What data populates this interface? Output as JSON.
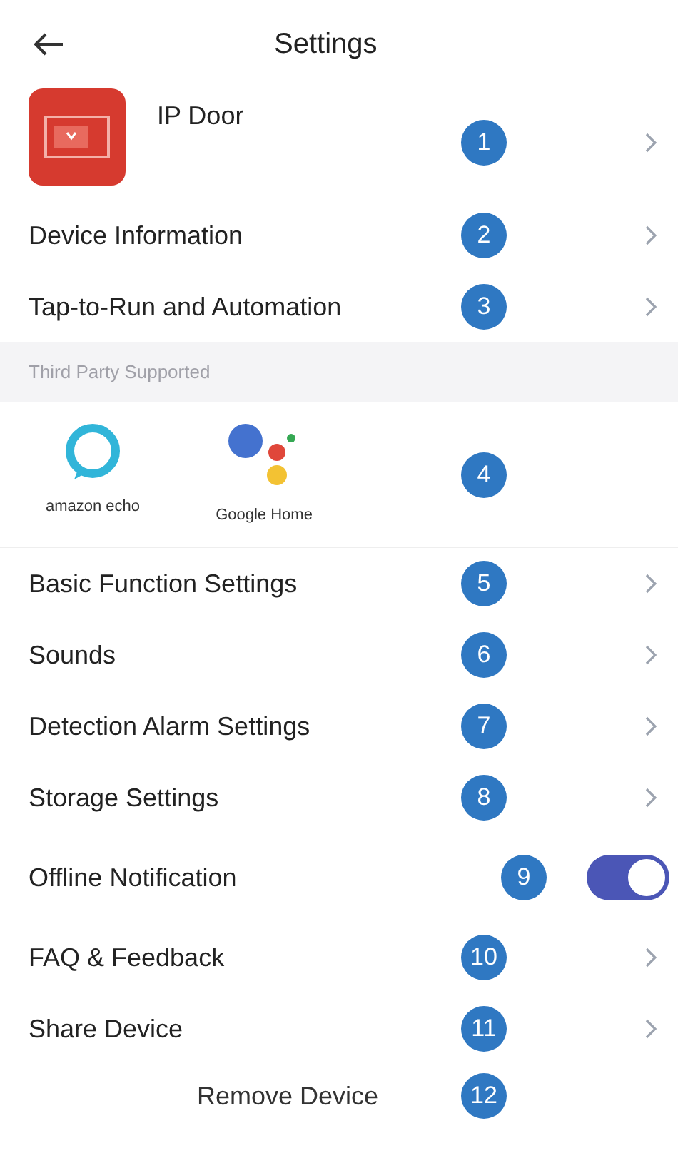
{
  "header": {
    "title": "Settings"
  },
  "device": {
    "name": "IP Door",
    "marker": "1"
  },
  "rows": [
    {
      "kind": "link",
      "label": "Device Information",
      "marker": "2"
    },
    {
      "kind": "link",
      "label": "Tap-to-Run and Automation",
      "marker": "3"
    },
    {
      "kind": "section",
      "label": "Third Party Supported"
    },
    {
      "kind": "integrations",
      "services": [
        "amazon echo",
        "Google Home"
      ],
      "marker": "4"
    },
    {
      "kind": "link",
      "label": "Basic Function Settings",
      "marker": "5"
    },
    {
      "kind": "link",
      "label": "Sounds",
      "marker": "6"
    },
    {
      "kind": "link",
      "label": "Detection Alarm Settings",
      "marker": "7"
    },
    {
      "kind": "link",
      "label": "Storage Settings",
      "marker": "8"
    },
    {
      "kind": "toggle",
      "label": "Offline Notification",
      "marker": "9",
      "on": true
    },
    {
      "kind": "link",
      "label": "FAQ & Feedback",
      "marker": "10"
    },
    {
      "kind": "link",
      "label": "Share Device",
      "marker": "11"
    },
    {
      "kind": "action",
      "label": "Remove Device",
      "marker": "12"
    }
  ]
}
